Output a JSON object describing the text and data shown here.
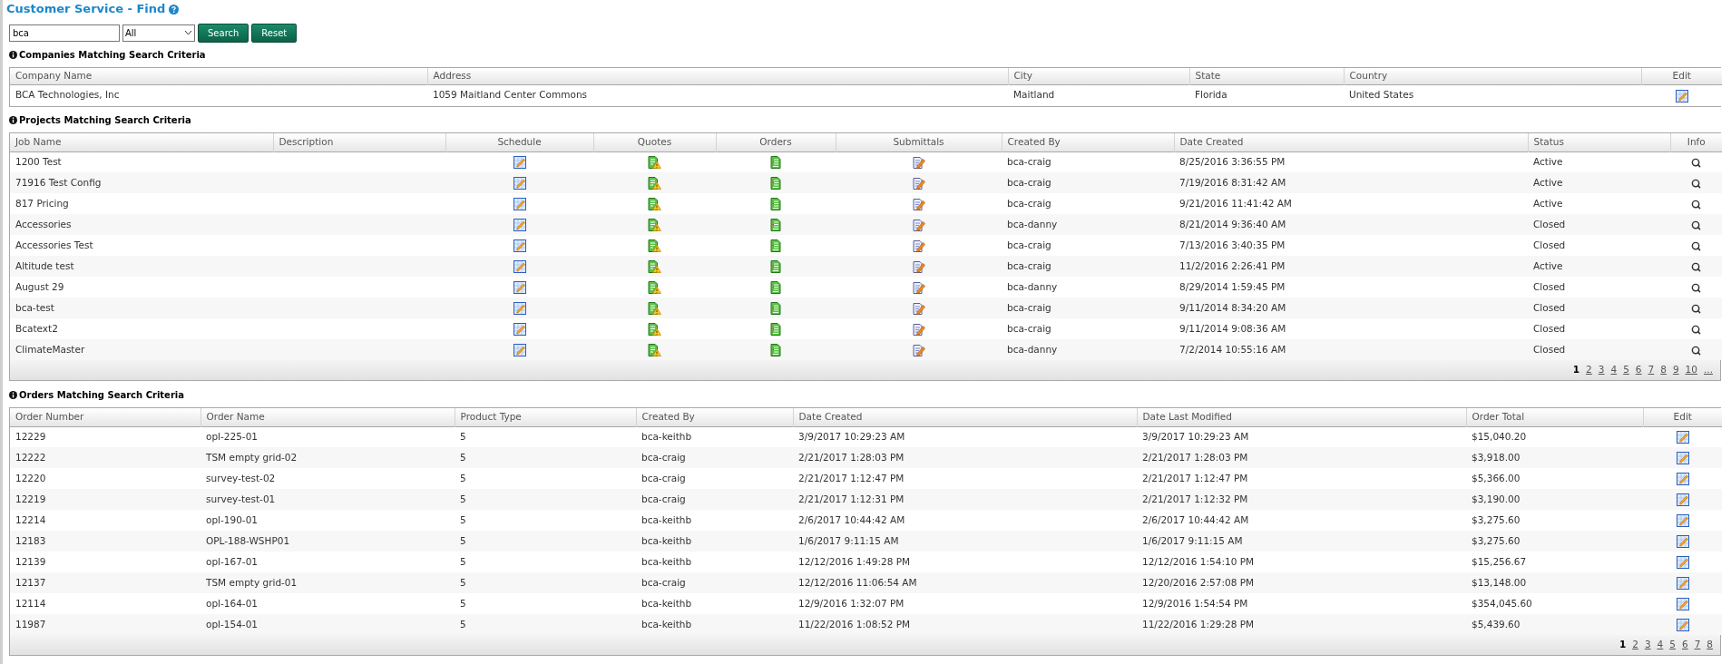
{
  "title": "Customer Service - Find",
  "search": {
    "value": "bca",
    "filter": "All",
    "buttons": [
      "Search",
      "Reset"
    ]
  },
  "companies": {
    "heading": "Companies Matching Search Criteria",
    "columns": [
      {
        "label": "Company Name",
        "kind": "text"
      },
      {
        "label": "Address",
        "kind": "text"
      },
      {
        "label": "City",
        "kind": "text"
      },
      {
        "label": "State",
        "kind": "text"
      },
      {
        "label": "Country",
        "kind": "text"
      },
      {
        "label": "Edit",
        "kind": "edit"
      }
    ],
    "rows": [
      {
        "cells": [
          "BCA Technologies, Inc",
          "1059 Maitland Center Commons",
          "Maitland",
          "Florida",
          "United States"
        ]
      }
    ]
  },
  "projects": {
    "heading": "Projects Matching Search Criteria",
    "columns": [
      {
        "label": "Job Name",
        "kind": "text"
      },
      {
        "label": "Description",
        "kind": "blank"
      },
      {
        "label": "Schedule",
        "kind": "edit"
      },
      {
        "label": "Quotes",
        "kind": "quote"
      },
      {
        "label": "Orders",
        "kind": "order"
      },
      {
        "label": "Submittals",
        "kind": "submittal"
      },
      {
        "label": "Created By",
        "kind": "text"
      },
      {
        "label": "Date Created",
        "kind": "text"
      },
      {
        "label": "Status",
        "kind": "text"
      },
      {
        "label": "Info",
        "kind": "info"
      }
    ],
    "rows": [
      {
        "cells": [
          "1200 Test",
          "bca-craig",
          "8/25/2016 3:36:55 PM",
          "Active"
        ]
      },
      {
        "cells": [
          "71916 Test Config",
          "bca-craig",
          "7/19/2016 8:31:42 AM",
          "Active"
        ]
      },
      {
        "cells": [
          "817 Pricing",
          "bca-craig",
          "9/21/2016 11:41:42 AM",
          "Active"
        ]
      },
      {
        "cells": [
          "Accessories",
          "bca-danny",
          "8/21/2014 9:36:40 AM",
          "Closed"
        ]
      },
      {
        "cells": [
          "Accessories Test",
          "bca-craig",
          "7/13/2016 3:40:35 PM",
          "Closed"
        ]
      },
      {
        "cells": [
          "Altitude test",
          "bca-craig",
          "11/2/2016 2:26:41 PM",
          "Active"
        ]
      },
      {
        "cells": [
          "August 29",
          "bca-danny",
          "8/29/2014 1:59:45 PM",
          "Closed"
        ]
      },
      {
        "cells": [
          "bca-test",
          "bca-craig",
          "9/11/2014 8:34:20 AM",
          "Closed"
        ]
      },
      {
        "cells": [
          "Bcatext2",
          "bca-craig",
          "9/11/2014 9:08:36 AM",
          "Closed"
        ]
      },
      {
        "cells": [
          "ClimateMaster",
          "bca-danny",
          "7/2/2014 10:55:16 AM",
          "Closed"
        ]
      }
    ],
    "pager": [
      {
        "label": "1",
        "selected": true
      },
      {
        "label": "2",
        "selected": false
      },
      {
        "label": "3",
        "selected": false
      },
      {
        "label": "4",
        "selected": false
      },
      {
        "label": "5",
        "selected": false
      },
      {
        "label": "6",
        "selected": false
      },
      {
        "label": "7",
        "selected": false
      },
      {
        "label": "8",
        "selected": false
      },
      {
        "label": "9",
        "selected": false
      },
      {
        "label": "10",
        "selected": false
      },
      {
        "label": "...",
        "selected": false
      }
    ]
  },
  "orders": {
    "heading": "Orders Matching Search Criteria",
    "columns": [
      {
        "label": "Order Number",
        "kind": "text"
      },
      {
        "label": "Order Name",
        "kind": "text"
      },
      {
        "label": "Product Type",
        "kind": "text"
      },
      {
        "label": "Created By",
        "kind": "text"
      },
      {
        "label": "Date Created",
        "kind": "text"
      },
      {
        "label": "Date Last Modified",
        "kind": "text"
      },
      {
        "label": "Order Total",
        "kind": "text"
      },
      {
        "label": "Edit",
        "kind": "edit"
      }
    ],
    "rows": [
      {
        "cells": [
          "12229",
          "opl-225-01",
          "5",
          "bca-keithb",
          "3/9/2017 10:29:23 AM",
          "3/9/2017 10:29:23 AM",
          "$15,040.20"
        ]
      },
      {
        "cells": [
          "12222",
          "TSM empty grid-02",
          "5",
          "bca-craig",
          "2/21/2017 1:28:03 PM",
          "2/21/2017 1:28:03 PM",
          "$3,918.00"
        ]
      },
      {
        "cells": [
          "12220",
          "survey-test-02",
          "5",
          "bca-craig",
          "2/21/2017 1:12:47 PM",
          "2/21/2017 1:12:47 PM",
          "$5,366.00"
        ]
      },
      {
        "cells": [
          "12219",
          "survey-test-01",
          "5",
          "bca-craig",
          "2/21/2017 1:12:31 PM",
          "2/21/2017 1:12:32 PM",
          "$3,190.00"
        ]
      },
      {
        "cells": [
          "12214",
          "opl-190-01",
          "5",
          "bca-keithb",
          "2/6/2017 10:44:42 AM",
          "2/6/2017 10:44:42 AM",
          "$3,275.60"
        ]
      },
      {
        "cells": [
          "12183",
          "OPL-188-WSHP01",
          "5",
          "bca-keithb",
          "1/6/2017 9:11:15 AM",
          "1/6/2017 9:11:15 AM",
          "$3,275.60"
        ]
      },
      {
        "cells": [
          "12139",
          "opl-167-01",
          "5",
          "bca-keithb",
          "12/12/2016 1:49:28 PM",
          "12/12/2016 1:54:10 PM",
          "$15,256.67"
        ]
      },
      {
        "cells": [
          "12137",
          "TSM empty grid-01",
          "5",
          "bca-craig",
          "12/12/2016 11:06:54 AM",
          "12/20/2016 2:57:08 PM",
          "$13,148.00"
        ]
      },
      {
        "cells": [
          "12114",
          "opl-164-01",
          "5",
          "bca-keithb",
          "12/9/2016 1:32:07 PM",
          "12/9/2016 1:54:54 PM",
          "$354,045.60"
        ]
      },
      {
        "cells": [
          "11987",
          "opl-154-01",
          "5",
          "bca-keithb",
          "11/22/2016 1:08:52 PM",
          "11/22/2016 1:29:28 PM",
          "$5,439.60"
        ]
      }
    ],
    "pager": [
      {
        "label": "1",
        "selected": true
      },
      {
        "label": "2",
        "selected": false
      },
      {
        "label": "3",
        "selected": false
      },
      {
        "label": "4",
        "selected": false
      },
      {
        "label": "5",
        "selected": false
      },
      {
        "label": "6",
        "selected": false
      },
      {
        "label": "7",
        "selected": false
      },
      {
        "label": "8",
        "selected": false
      }
    ]
  }
}
